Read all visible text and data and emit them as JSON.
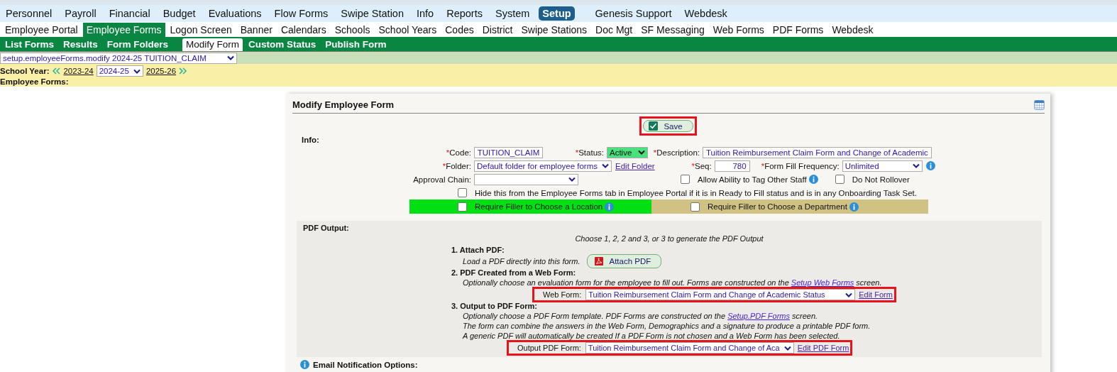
{
  "top_menu": [
    {
      "label": "Personnel",
      "selected": false
    },
    {
      "label": "Payroll",
      "selected": false
    },
    {
      "label": "Financial",
      "selected": false
    },
    {
      "label": "Budget",
      "selected": false
    },
    {
      "label": "Evaluations",
      "selected": false
    },
    {
      "label": "Flow Forms",
      "selected": false
    },
    {
      "label": "Swipe Station",
      "selected": false
    },
    {
      "label": "Info",
      "selected": false
    },
    {
      "label": "Reports",
      "selected": false
    },
    {
      "label": "System",
      "selected": false
    },
    {
      "label": "Setup",
      "selected": true
    }
  ],
  "top_links": [
    "Genesis Support",
    "Webdesk"
  ],
  "sub_menu": [
    {
      "label": "Employee Portal",
      "selected": false
    },
    {
      "label": "Employee Forms",
      "selected": true
    },
    {
      "label": "Logon Screen",
      "selected": false
    },
    {
      "label": "Banner",
      "selected": false
    },
    {
      "label": "Calendars",
      "selected": false
    },
    {
      "label": "Schools",
      "selected": false
    },
    {
      "label": "School Years",
      "selected": false
    },
    {
      "label": "Codes",
      "selected": false
    },
    {
      "label": "District",
      "selected": false
    },
    {
      "label": "Swipe Stations",
      "selected": false
    },
    {
      "label": "Doc Mgt",
      "selected": false
    },
    {
      "label": "SF Messaging",
      "selected": false
    },
    {
      "label": "Web Forms",
      "selected": false
    },
    {
      "label": "PDF Forms",
      "selected": false
    },
    {
      "label": "Webdesk",
      "selected": false
    }
  ],
  "tabs": [
    {
      "label": "List Forms",
      "selected": false
    },
    {
      "label": "Results",
      "selected": false
    },
    {
      "label": "Form Folders",
      "selected": false
    },
    {
      "label": "Modify Form",
      "selected": true
    },
    {
      "label": "Custom Status",
      "selected": false
    },
    {
      "label": "Publish Form",
      "selected": false
    }
  ],
  "page_select": "setup.employeeForms.modify 2024-25 TUITION_CLAIM",
  "school_year": {
    "label": "School Year:",
    "prev": "2023-24",
    "value": "2024-25",
    "next": "2025-26"
  },
  "section_label": "Employee Forms:",
  "panel": {
    "title": "Modify Employee Form",
    "save": {
      "label": "Save",
      "highlighted": true
    },
    "info": {
      "heading": "Info:",
      "code": {
        "mark": "*",
        "label": "Code:",
        "value": "TUITION_CLAIM"
      },
      "status": {
        "mark": "*",
        "label": "Status:",
        "value": "Active"
      },
      "description": {
        "mark": "*",
        "label": "Description:",
        "value": "Tuition Reimbursement Claim Form and Change of Academic"
      },
      "folder": {
        "mark": "*",
        "label": "Folder:",
        "value": "Default folder for employee forms",
        "link": "Edit Folder"
      },
      "seq": {
        "mark": "*",
        "label": "Seq:",
        "value": "780"
      },
      "frequency": {
        "mark": "*",
        "label": "Form Fill Frequency:",
        "value": "Unlimited"
      },
      "approval": {
        "label": "Approval Chain:"
      },
      "tag_staff": {
        "label": "Allow Ability to Tag Other Staff",
        "checked": false
      },
      "rollover": {
        "label": "Do Not Rollover",
        "checked": false
      },
      "hide": {
        "label": "Hide this from the Employee Forms tab in Employee Portal if it is in Ready to Fill status and is in any Onboarding Task Set.",
        "checked": false
      },
      "location": {
        "label": "Require Filler to Choose a Location",
        "checked": false
      },
      "department": {
        "label": "Require Filler to Choose a Department",
        "checked": false
      }
    },
    "pdf": {
      "heading": "PDF Output:",
      "intro": "Choose 1, 2, 2 and 3, or 3 to generate the PDF Output",
      "step1": {
        "title": "1. Attach PDF:",
        "text": "Load a PDF directly into this form.",
        "button": "Attach PDF"
      },
      "step2": {
        "title": "2. PDF Created from a Web Form:",
        "text": "Optionally choose an evaluation form for the employee to fill out. Forms are constructed on the ",
        "link": "Setup Web Forms",
        "after": " screen.",
        "field_label": "Web Form:",
        "value": "Tuition Reimbursement Claim Form and Change of Academic Status",
        "edit": "Edit Form",
        "highlighted": true
      },
      "step3": {
        "title": "3. Output to PDF Form:",
        "text": "Optionally choose a PDF Form template. PDF Forms are constructed on the ",
        "link": "Setup.PDF Forms",
        "after": " screen.",
        "lines": [
          "The form can combine the answers in the Web Form, Demographics and a signature to produce a printable PDF form.",
          "A generic PDF will automatically be created If a PDF Form is not chosen and a Web Form has been selected."
        ],
        "field_label": "Output PDF Form:",
        "value": "Tuition Reimbursement Claim Form and Change of Aca",
        "edit": "Edit PDF Form",
        "highlighted": true
      }
    },
    "email_heading": "Email Notification Options:"
  }
}
